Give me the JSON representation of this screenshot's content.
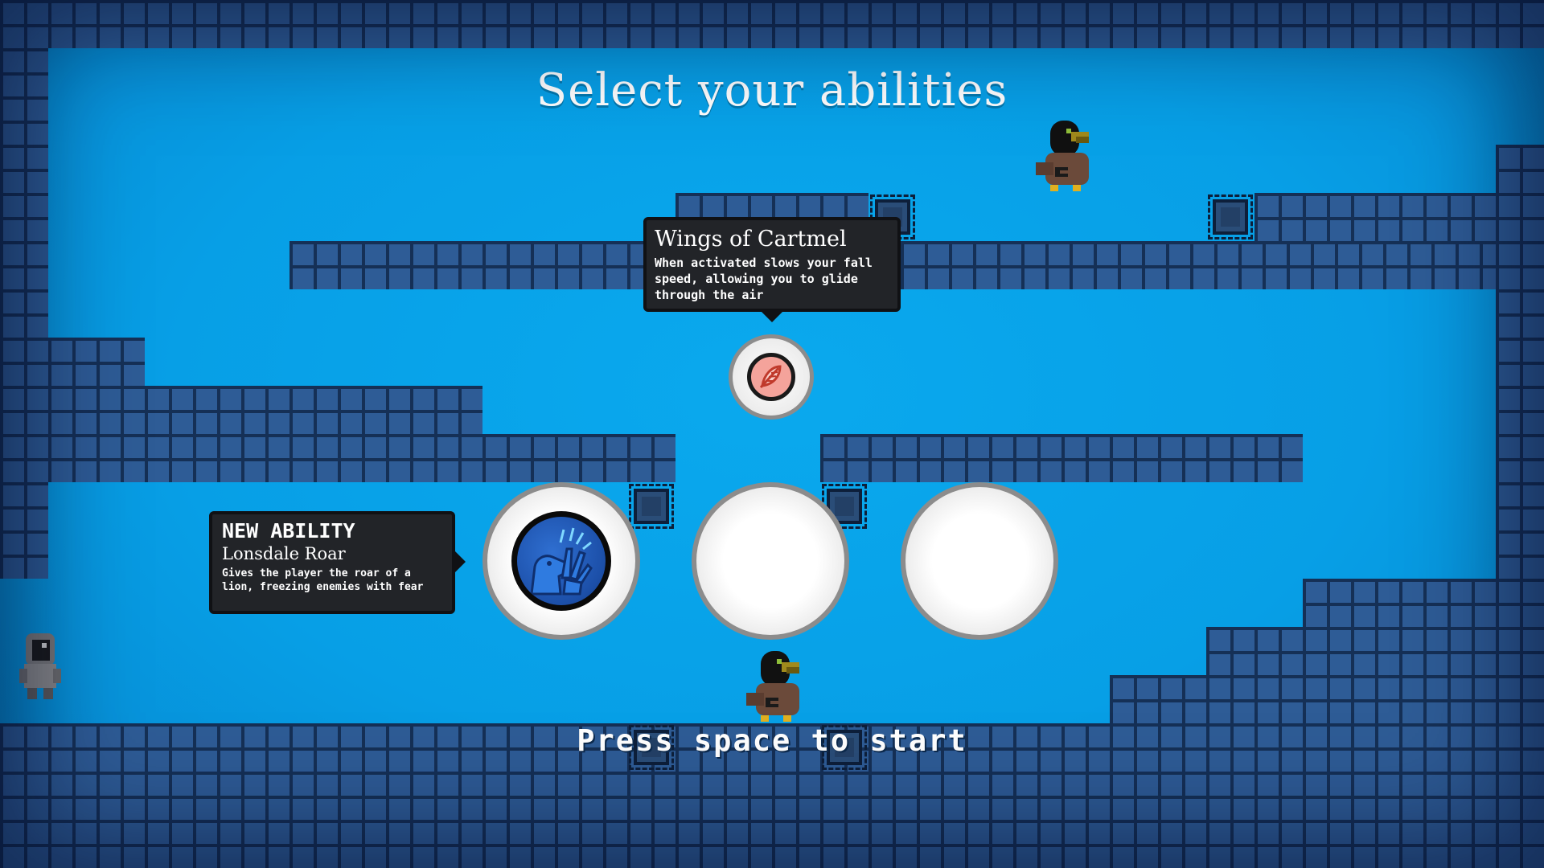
{
  "screen": {
    "title": "Select your abilities",
    "prompt": "Press space to start"
  },
  "selected_ability_tooltip": {
    "name": "Wings of Cartmel",
    "description": "When activated slows your fall speed, allowing you to glide through the air",
    "icon": "feather-icon"
  },
  "new_ability_tooltip": {
    "heading": "NEW ABILITY",
    "name": "Lonsdale Roar",
    "description": "Gives the player the roar of a lion, freezing enemies with fear",
    "icon": "roar-hand-icon"
  },
  "ability_slots": [
    {
      "state": "filled",
      "ability": "Lonsdale Roar",
      "icon": "roar-hand-icon"
    },
    {
      "state": "empty"
    },
    {
      "state": "empty"
    }
  ],
  "colors": {
    "sky": "#06a2e8",
    "brick": "#2e5c96",
    "mortar": "#153056",
    "tooltip_bg": "#222428",
    "roar_icon": "#1c4fa8",
    "feather_icon": "#f4a39b"
  },
  "characters": [
    {
      "kind": "crow",
      "icon": "crow-icon"
    },
    {
      "kind": "crow",
      "icon": "crow-icon"
    },
    {
      "kind": "hooded-knight",
      "icon": "knight-icon"
    }
  ]
}
